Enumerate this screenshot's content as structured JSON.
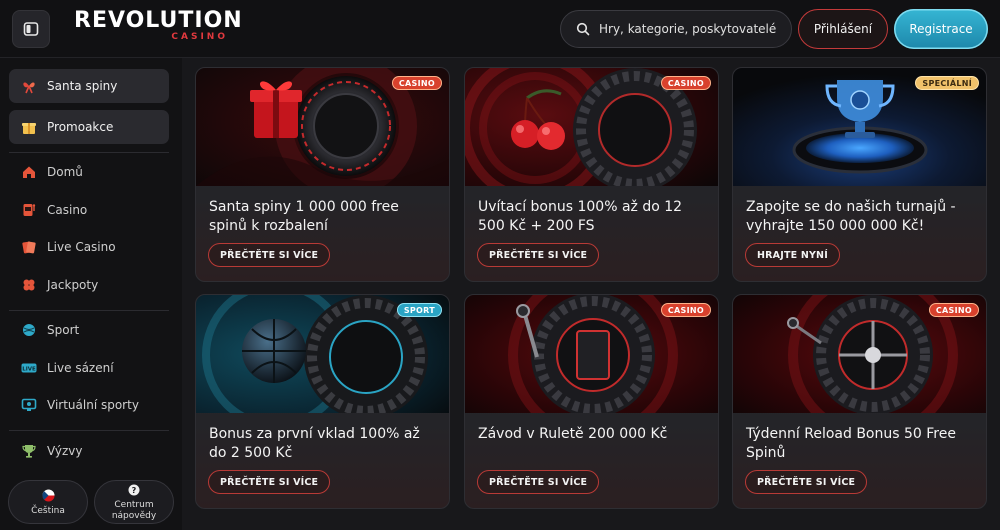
{
  "header": {
    "menu_toggle_icon": "sidebar-toggle-icon",
    "logo_main": "REVOLUTION",
    "logo_sub": "CASINO",
    "search_placeholder": "Hry, kategorie, poskytovatelé",
    "login_label": "Přihlášení",
    "register_label": "Registrace"
  },
  "sidebar": {
    "promos": [
      {
        "label": "Santa spiny",
        "icon": "gift-bow-icon"
      },
      {
        "label": "Promoakce",
        "icon": "gift-box-icon"
      }
    ],
    "casino_nav": [
      {
        "label": "Domů",
        "icon": "home-icon"
      },
      {
        "label": "Casino",
        "icon": "slot-machine-icon"
      },
      {
        "label": "Live Casino",
        "icon": "card-dealer-icon"
      },
      {
        "label": "Jackpoty",
        "icon": "clover-icon"
      }
    ],
    "sport_nav": [
      {
        "label": "Sport",
        "icon": "ball-icon"
      },
      {
        "label": "Live sázení",
        "icon": "live-badge-icon"
      },
      {
        "label": "Virtuální sporty",
        "icon": "monitor-icon"
      }
    ],
    "extra_nav": [
      {
        "label": "Výzvy",
        "icon": "trophy-icon"
      }
    ],
    "language_label": "Čeština",
    "help_label_line1": "Centrum",
    "help_label_line2": "nápovědy",
    "live_badge_text": "LIVE"
  },
  "cards": [
    {
      "title": "Santa spiny 1 000 000 free spinů k rozbalení",
      "badge": "CASINO",
      "button": "PŘEČTĚTE SI VÍCE"
    },
    {
      "title": "Uvítací bonus 100% až do 12 500 Kč + 200 FS",
      "badge": "CASINO",
      "button": "PŘEČTĚTE SI VÍCE"
    },
    {
      "title": "Zapojte se do našich turnajů - vyhrajte 150 000 000 Kč!",
      "badge": "SPECIÁLNÍ",
      "button": "HRAJTE NYNÍ"
    },
    {
      "title": "Bonus za první vklad 100% až do 2 500 Kč",
      "badge": "SPORT",
      "button": "PŘEČTĚTE SI VÍCE"
    },
    {
      "title": "Závod v Ruletě 200 000 Kč",
      "badge": "CASINO",
      "button": "PŘEČTĚTE SI VÍCE"
    },
    {
      "title": "Týdenní Reload Bonus 50 Free Spinů",
      "badge": "CASINO",
      "button": "PŘEČTĚTE SI VÍCE"
    }
  ],
  "colors": {
    "accent_red": "#d8412d",
    "accent_cyan": "#2aa4c4",
    "special_gold": "#f1c26a",
    "background": "#17171a"
  }
}
